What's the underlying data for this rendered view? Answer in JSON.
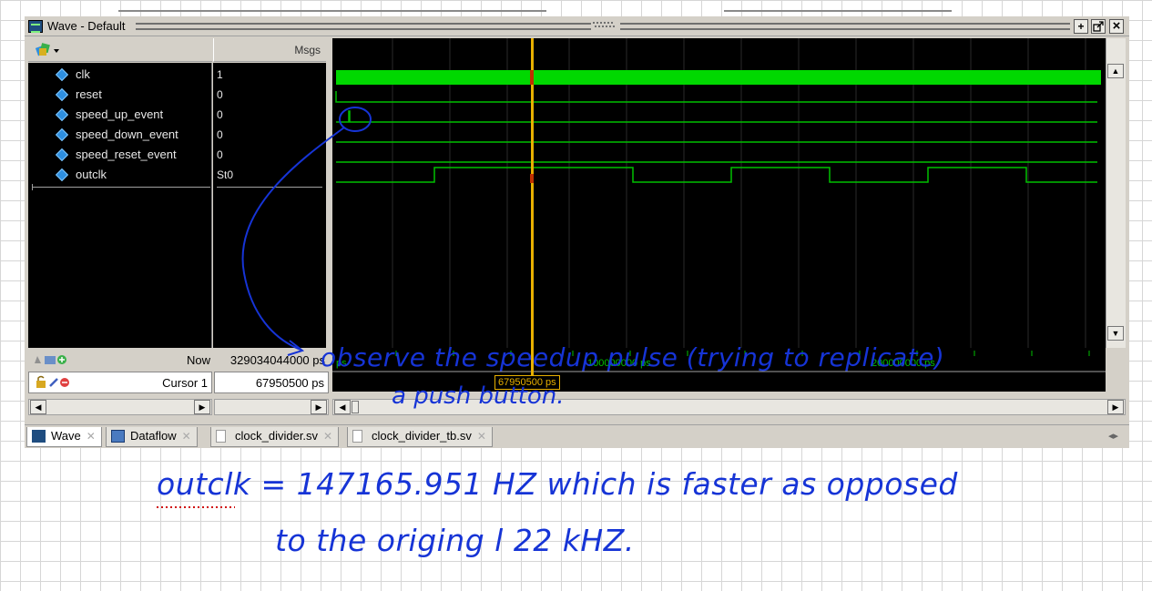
{
  "window": {
    "title": "Wave - Default"
  },
  "toolbar": {
    "plus": "+",
    "restore": "↗",
    "close": "×"
  },
  "names_header": {
    "msgs_label": "Msgs"
  },
  "signals": [
    {
      "name": "clk",
      "value": "1"
    },
    {
      "name": "reset",
      "value": "0"
    },
    {
      "name": "speed_up_event",
      "value": "0"
    },
    {
      "name": "speed_down_event",
      "value": "0"
    },
    {
      "name": "speed_reset_event",
      "value": "0"
    },
    {
      "name": "outclk",
      "value": "St0"
    }
  ],
  "status": {
    "now_label": "Now",
    "now_value": "329034044000 ps",
    "cursor_label": "Cursor 1",
    "cursor_value": "67950500 ps",
    "cursor_flag": "67950500 ps",
    "timeline_start": "ps",
    "timeline_mid": "100000000 ps",
    "timeline_end": "200000000 ps"
  },
  "tabs": [
    {
      "label": "Wave",
      "active": true
    },
    {
      "label": "Dataflow",
      "active": false
    },
    {
      "label": "clock_divider.sv",
      "active": false
    },
    {
      "label": "clock_divider_tb.sv",
      "active": false
    }
  ],
  "notes": {
    "annotation_line1": "observe the speedup pulse (trying to replicate)",
    "annotation_line2": "a push button.",
    "line1": "outclk = 147165.951 HZ which is faster as opposed",
    "line2": "to the origing l 22 kHZ."
  },
  "colors": {
    "wave": "#00d800",
    "cursor": "#e8b000",
    "ink": "#1634d6"
  }
}
